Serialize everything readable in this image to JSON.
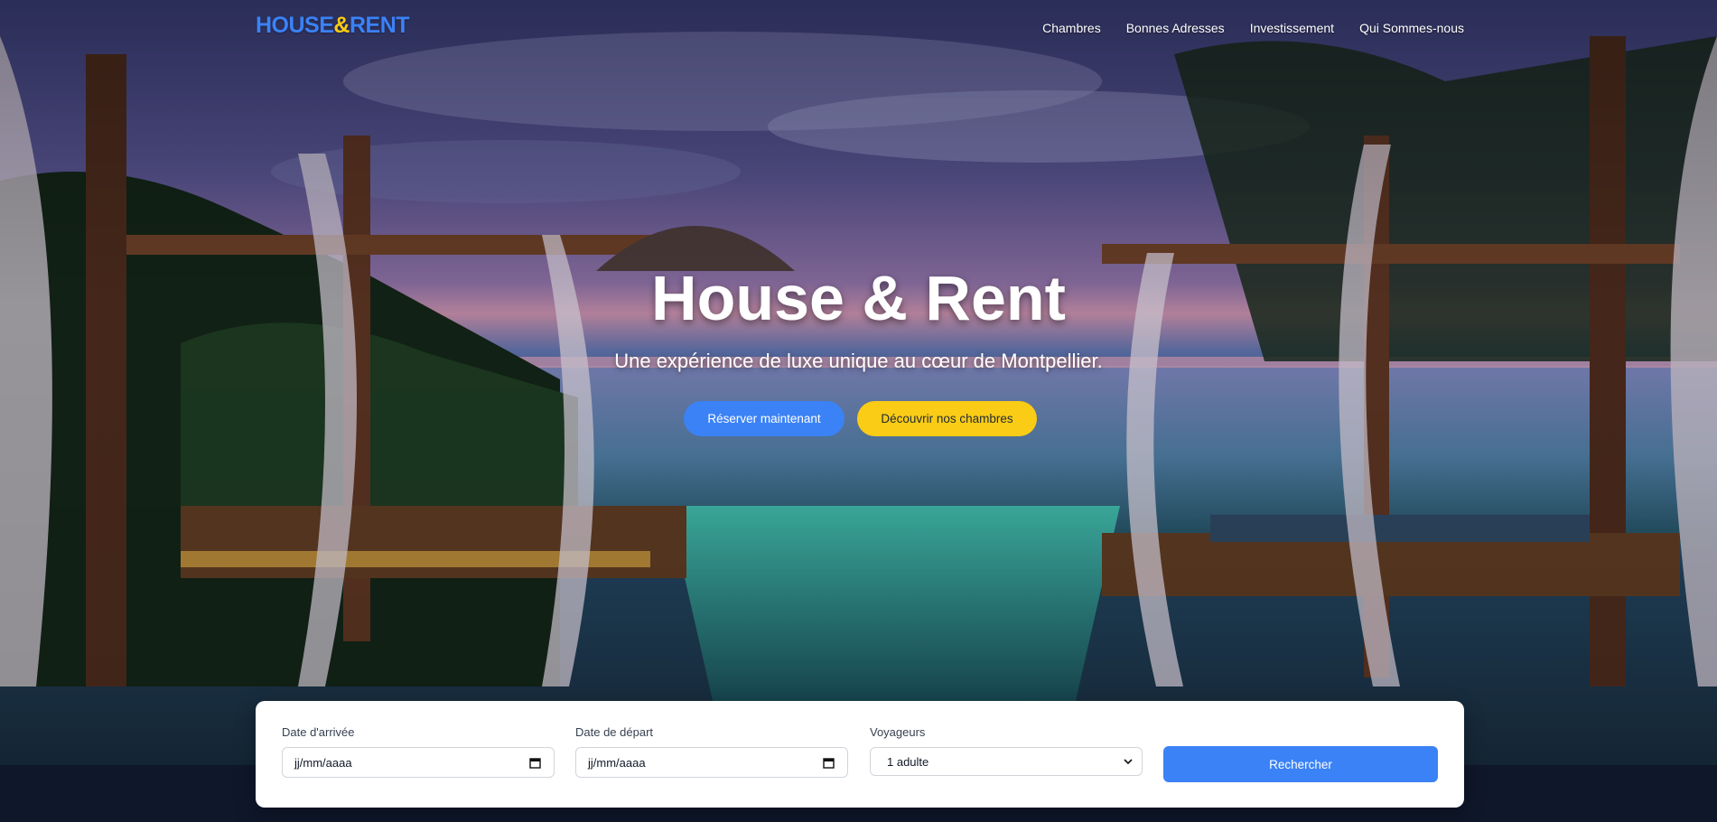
{
  "brand": {
    "logo_part1": "HOUSE",
    "logo_amp": "&",
    "logo_part2": "RENT"
  },
  "nav": {
    "items": [
      "Chambres",
      "Bonnes Adresses",
      "Investissement",
      "Qui Sommes-nous"
    ]
  },
  "hero": {
    "title": "House & Rent",
    "subtitle": "Une expérience de luxe unique au cœur de Montpellier.",
    "primary_cta": "Réserver maintenant",
    "secondary_cta": "Découvrir nos chambres"
  },
  "booking": {
    "arrival_label": "Date d'arrivée",
    "arrival_value": "jj/mm/aaaa",
    "departure_label": "Date de départ",
    "departure_value": "jj/mm/aaaa",
    "guests_label": "Voyageurs",
    "guests_value": "1 adulte",
    "search_label": "Rechercher"
  },
  "colors": {
    "accent_blue": "#3b82f6",
    "accent_yellow": "#facc15",
    "footer_dark": "#0f172a"
  }
}
